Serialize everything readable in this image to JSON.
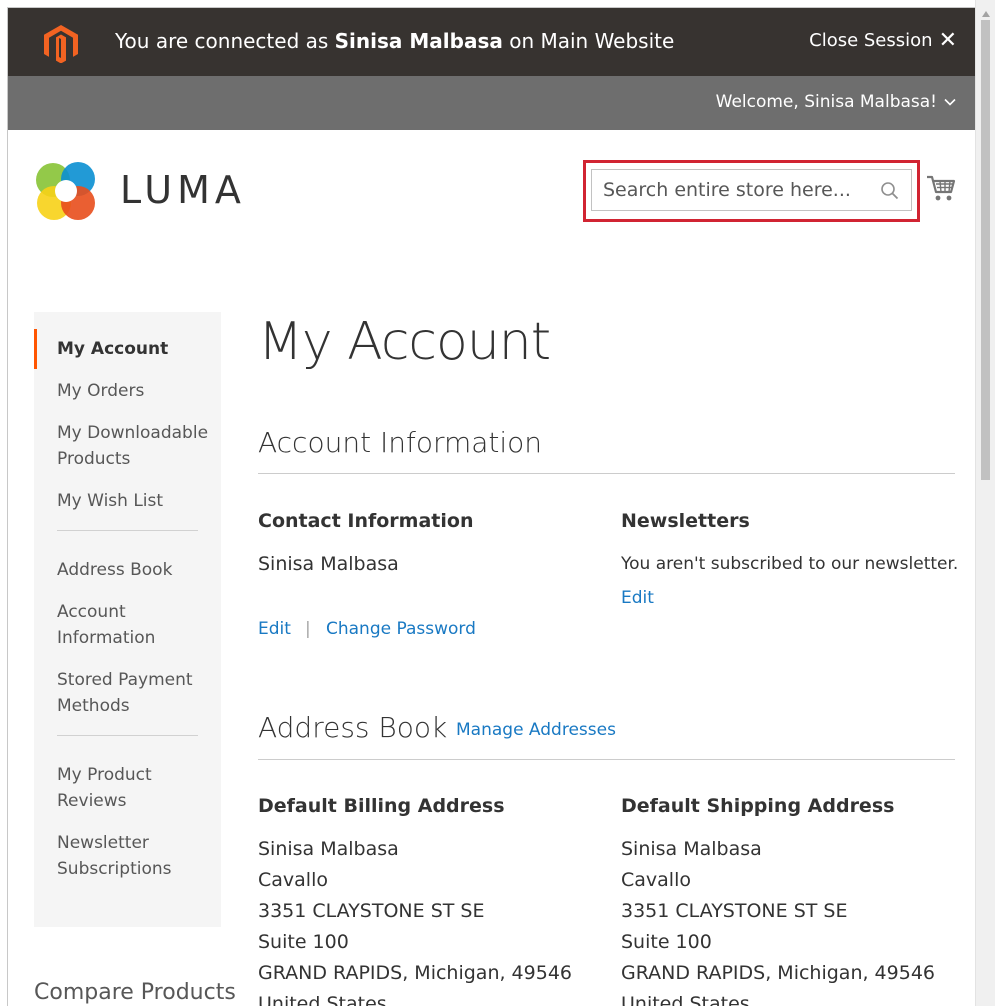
{
  "session_bar": {
    "prefix": "You are connected as ",
    "customer_name": "Sinisa Malbasa",
    "suffix": " on Main Website",
    "close_label": "Close Session",
    "close_glyph": "✕"
  },
  "welcome_bar": {
    "welcome_text": "Welcome, Sinisa Malbasa!"
  },
  "header": {
    "logo_text": "LUMA",
    "search_placeholder": "Search entire store here..."
  },
  "sidebar": {
    "group1": [
      {
        "label": "My Account",
        "active": true
      },
      {
        "label": "My Orders"
      },
      {
        "label": "My Downloadable Products"
      },
      {
        "label": "My Wish List"
      }
    ],
    "group2": [
      {
        "label": "Address Book"
      },
      {
        "label": "Account Information"
      },
      {
        "label": "Stored Payment Methods"
      }
    ],
    "group3": [
      {
        "label": "My Product Reviews"
      },
      {
        "label": "Newsletter Subscriptions"
      }
    ],
    "compare_title": "Compare Products"
  },
  "main": {
    "page_title": "My Account",
    "account_info": {
      "title": "Account Information",
      "contact_title": "Contact Information",
      "contact_name": "Sinisa Malbasa",
      "edit_label": "Edit",
      "separator": "|",
      "change_password_label": "Change Password",
      "newsletters_title": "Newsletters",
      "newsletters_text": "You aren't subscribed to our newsletter.",
      "newsletters_edit_label": "Edit"
    },
    "address_book": {
      "title": "Address Book",
      "manage_label": "Manage Addresses",
      "billing_title": "Default Billing Address",
      "billing_lines": [
        "Sinisa Malbasa",
        "Cavallo",
        "3351 CLAYSTONE ST SE",
        "Suite 100",
        "GRAND RAPIDS, Michigan, 49546",
        "United States"
      ],
      "shipping_title": "Default Shipping Address",
      "shipping_lines": [
        "Sinisa Malbasa",
        "Cavallo",
        "3351 CLAYSTONE ST SE",
        "Suite 100",
        "GRAND RAPIDS, Michigan, 49546",
        "United States"
      ]
    }
  },
  "colors": {
    "session_bar_bg": "#373330",
    "welcome_bar_bg": "#6e6e6e",
    "brand_orange": "#f26322",
    "link_blue": "#1979c3",
    "active_marker": "#ff5501",
    "highlight_red": "#d12432"
  },
  "icons": {
    "magento": "magento-logo-icon",
    "luma": "luma-logo-icon",
    "search": "search-icon",
    "cart": "cart-icon",
    "chevron": "chevron-down-icon",
    "close": "close-icon"
  }
}
